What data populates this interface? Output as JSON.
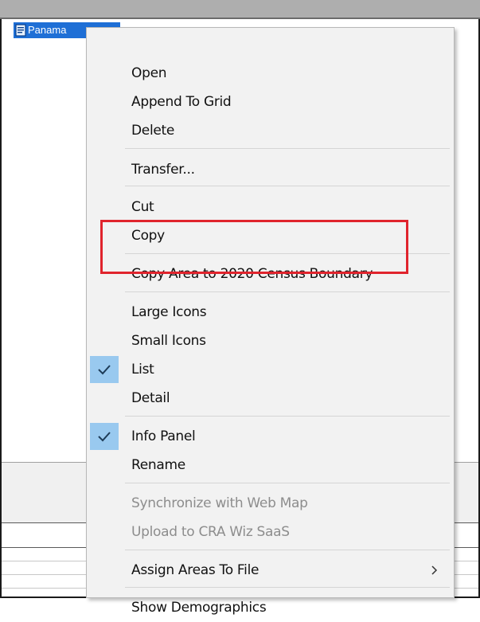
{
  "list": {
    "selected_item": "Panama",
    "selected_icon": "document-icon"
  },
  "menu": {
    "items": [
      {
        "label": "Open",
        "enabled": true,
        "checked": false
      },
      {
        "label": "Append To Grid",
        "enabled": true,
        "checked": false
      },
      {
        "label": "Delete",
        "enabled": true,
        "checked": false
      },
      {
        "label": "Transfer...",
        "enabled": true,
        "checked": false
      },
      {
        "label": "Cut",
        "enabled": true,
        "checked": false
      },
      {
        "label": "Copy",
        "enabled": true,
        "checked": false
      },
      {
        "label": "Copy Area to 2020 Census Boundary",
        "enabled": true,
        "checked": false,
        "highlighted": true
      },
      {
        "label": "Large Icons",
        "enabled": true,
        "checked": false
      },
      {
        "label": "Small Icons",
        "enabled": true,
        "checked": false
      },
      {
        "label": "List",
        "enabled": true,
        "checked": true
      },
      {
        "label": "Detail",
        "enabled": true,
        "checked": false
      },
      {
        "label": "Info Panel",
        "enabled": true,
        "checked": true
      },
      {
        "label": "Rename",
        "enabled": true,
        "checked": false
      },
      {
        "label": "Synchronize with Web Map",
        "enabled": false,
        "checked": false
      },
      {
        "label": "Upload to CRA Wiz SaaS",
        "enabled": false,
        "checked": false
      },
      {
        "label": "Assign Areas To File",
        "enabled": true,
        "checked": false,
        "submenu": true
      },
      {
        "label": "Show Demographics",
        "enabled": true,
        "checked": false
      }
    ]
  },
  "colors": {
    "selection": "#1e6fd6",
    "check_background": "#99c9ef",
    "highlight_box": "#e0242d",
    "menu_background": "#f2f2f2",
    "disabled_text": "#8d8d8d"
  }
}
